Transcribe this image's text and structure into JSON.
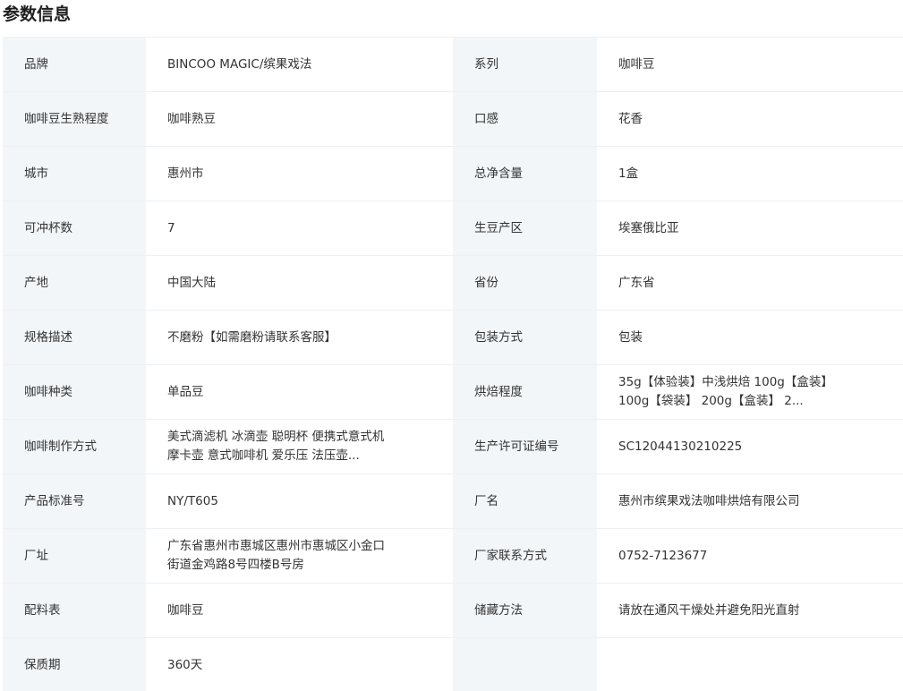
{
  "section": {
    "title": "参数信息"
  },
  "rows": [
    [
      {
        "label": "品牌",
        "value": "BINCOO MAGIC/缤果戏法"
      },
      {
        "label": "系列",
        "value": "咖啡豆"
      }
    ],
    [
      {
        "label": "咖啡豆生熟程度",
        "value": "咖啡熟豆"
      },
      {
        "label": "口感",
        "value": "花香"
      }
    ],
    [
      {
        "label": "城市",
        "value": "惠州市"
      },
      {
        "label": "总净含量",
        "value": "1盒"
      }
    ],
    [
      {
        "label": "可冲杯数",
        "value": "7"
      },
      {
        "label": "生豆产区",
        "value": "埃塞俄比亚"
      }
    ],
    [
      {
        "label": "产地",
        "value": "中国大陆"
      },
      {
        "label": "省份",
        "value": "广东省"
      }
    ],
    [
      {
        "label": "规格描述",
        "value": "不磨粉【如需磨粉请联系客服】"
      },
      {
        "label": "包装方式",
        "value": "包装"
      }
    ],
    [
      {
        "label": "咖啡种类",
        "value": "单品豆"
      },
      {
        "label": "烘焙程度",
        "value": "35g【体验装】中浅烘焙 100g【盒装】 100g【袋装】 200g【盒装】 2..."
      }
    ],
    [
      {
        "label": "咖啡制作方式",
        "value": "美式滴滤机 冰滴壶 聪明杯 便携式意式机 摩卡壶 意式咖啡机 爱乐压 法压壶..."
      },
      {
        "label": "生产许可证编号",
        "value": "SC12044130210225"
      }
    ],
    [
      {
        "label": "产品标准号",
        "value": "NY/T605"
      },
      {
        "label": "厂名",
        "value": "惠州市缤果戏法咖啡烘焙有限公司"
      }
    ],
    [
      {
        "label": "厂址",
        "value": "广东省惠州市惠城区惠州市惠城区小金口街道金鸡路8号四楼B号房"
      },
      {
        "label": "厂家联系方式",
        "value": "0752-7123677"
      }
    ],
    [
      {
        "label": "配料表",
        "value": "咖啡豆"
      },
      {
        "label": "储藏方法",
        "value": "请放在通风干燥处并避免阳光直射"
      }
    ],
    [
      {
        "label": "保质期",
        "value": "360天"
      },
      {
        "label": "",
        "value": ""
      }
    ]
  ]
}
